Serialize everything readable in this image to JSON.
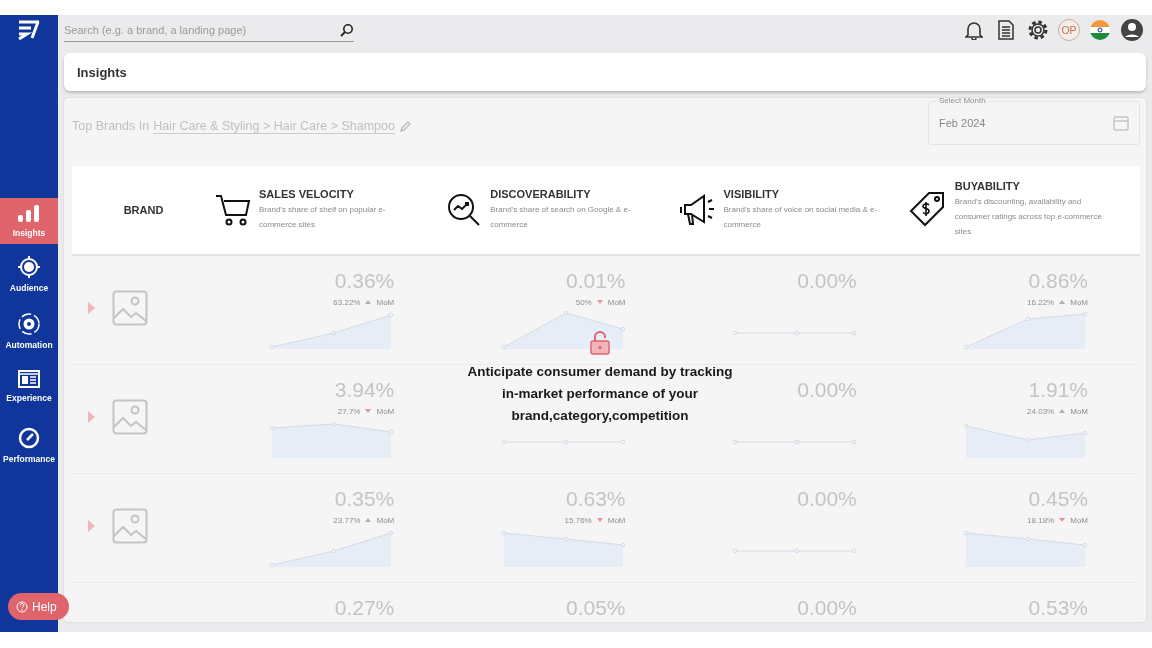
{
  "search": {
    "placeholder": "Search (e.g. a brand, a landing page)"
  },
  "toolbar": {
    "avatar_initials": "OP"
  },
  "sidebar": {
    "items": [
      {
        "label": "Insights",
        "selected": true
      },
      {
        "label": "Audience",
        "selected": false
      },
      {
        "label": "Automation",
        "selected": false
      },
      {
        "label": "Experience",
        "selected": false
      },
      {
        "label": "Performance",
        "selected": false
      }
    ],
    "help": "Help"
  },
  "page_title": "Insights",
  "breadcrumb": {
    "prefix": "Top Brands In",
    "path": "Hair Care & Styling > Hair Care > Shampoo"
  },
  "month_picker": {
    "label": "Select Month",
    "value": "Feb 2024"
  },
  "table": {
    "brand_heading": "BRAND",
    "columns": [
      {
        "title": "SALES VELOCITY",
        "description": "Brand's share of shelf on popular e-commerce sites"
      },
      {
        "title": "DISCOVERABILITY",
        "description": "Brand's share of search on Google & e-commerce"
      },
      {
        "title": "VISIBILITY",
        "description": "Brand's share of voice on social media & e-commerce"
      },
      {
        "title": "BUYABILITY",
        "description": "Brand's discounting, availability and consumer ratings across top e-commerce sites"
      }
    ],
    "rows": [
      {
        "expanded": false,
        "cells": [
          {
            "value": "0.36%",
            "change": "63.22%",
            "rising": true,
            "period": "MoM"
          },
          {
            "value": "0.01%",
            "change": "50%",
            "rising": false,
            "period": "MoM"
          },
          {
            "value": "0.00%"
          },
          {
            "value": "0.86%",
            "change": "16.22%",
            "rising": true,
            "period": "MoM"
          }
        ]
      },
      {
        "expanded": false,
        "cells": [
          {
            "value": "3.94%",
            "change": "27.7%",
            "rising": false,
            "period": "MoM"
          },
          {},
          {
            "value": "0.00%"
          },
          {
            "value": "1.91%",
            "change": "24.03%",
            "rising": true,
            "period": "MoM"
          }
        ]
      },
      {
        "expanded": false,
        "cells": [
          {
            "value": "0.35%",
            "change": "23.77%",
            "rising": true,
            "period": "MoM"
          },
          {
            "value": "0.63%",
            "change": "15.76%",
            "rising": false,
            "period": "MoM"
          },
          {
            "value": "0.00%"
          },
          {
            "value": "0.45%",
            "change": "18.18%",
            "rising": false,
            "period": "MoM"
          }
        ]
      },
      {
        "cells": [
          {
            "value": "0.27%"
          },
          {
            "value": "0.05%"
          },
          {
            "value": "0.00%"
          },
          {
            "value": "0.53%"
          }
        ]
      }
    ]
  },
  "locked_overlay": {
    "message": "Anticipate consumer demand by tracking in-market performance of your brand,category,competition"
  }
}
